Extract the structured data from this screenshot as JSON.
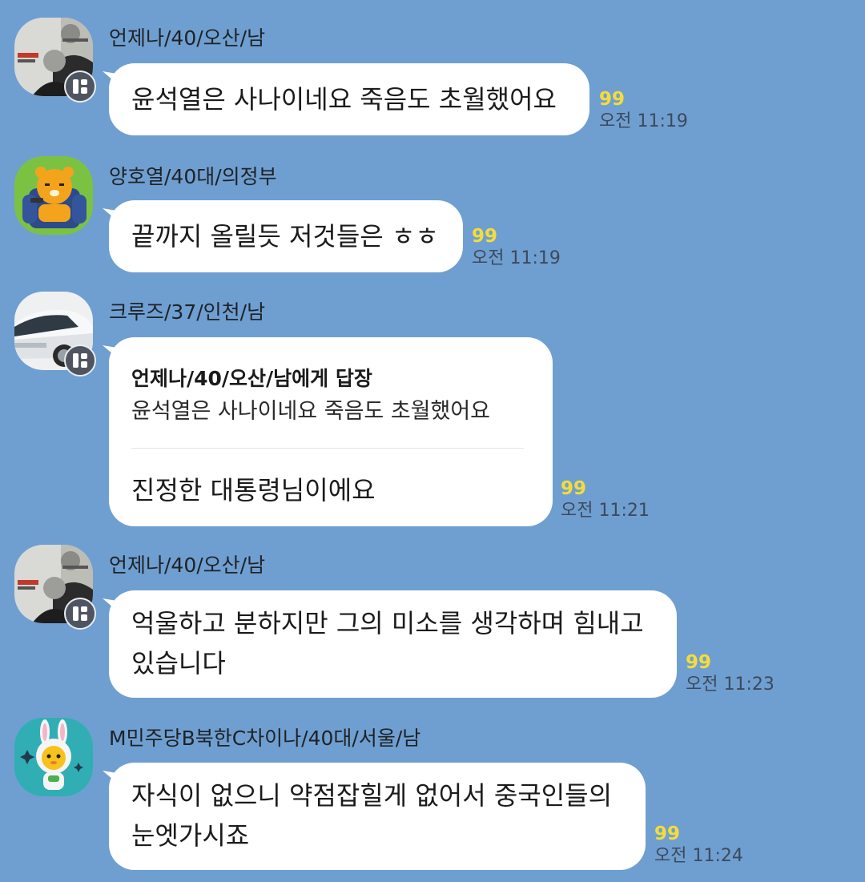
{
  "messages": [
    {
      "sender": "언제나/40/오산/남",
      "avatar": "politician-portrait-avatar",
      "text": "윤석열은 사나이네요 죽음도 초월했어요",
      "unread_count": "99",
      "time": "오전 11:19"
    },
    {
      "sender": "양호열/40대/의정부",
      "avatar": "ryan-bear-sofa-avatar",
      "text": "끝까지 올릴듯 저것들은 ㅎㅎ",
      "unread_count": "99",
      "time": "오전 11:19"
    },
    {
      "sender": "크루즈/37/인천/남",
      "avatar": "white-car-avatar",
      "reply_to": "언제나/40/오산/남에게 답장",
      "quoted": "윤석열은 사나이네요 죽음도 초월했어요",
      "text": "진정한 대통령님이에요",
      "unread_count": "99",
      "time": "오전 11:21"
    },
    {
      "sender": "언제나/40/오산/남",
      "avatar": "politician-portrait-avatar",
      "text_lines": [
        "억울하고 분하지만 그의 미소를 생각하며 힘내고",
        "있습니다"
      ],
      "unread_count": "99",
      "time": "오전 11:23"
    },
    {
      "sender": "M민주당B북한C차이나/40대/서울/남",
      "avatar": "rabbit-costume-character-avatar",
      "text_lines": [
        "자식이 없으니 약점잡힐게 없어서 중국인들의",
        "눈엣가시죠"
      ],
      "unread_count": "99",
      "time": "오전 11:24"
    }
  ],
  "colors": {
    "background": "#6f9fd0",
    "bubble": "#ffffff",
    "unread": "#f4dc3b",
    "time": "#3c4a5c"
  }
}
